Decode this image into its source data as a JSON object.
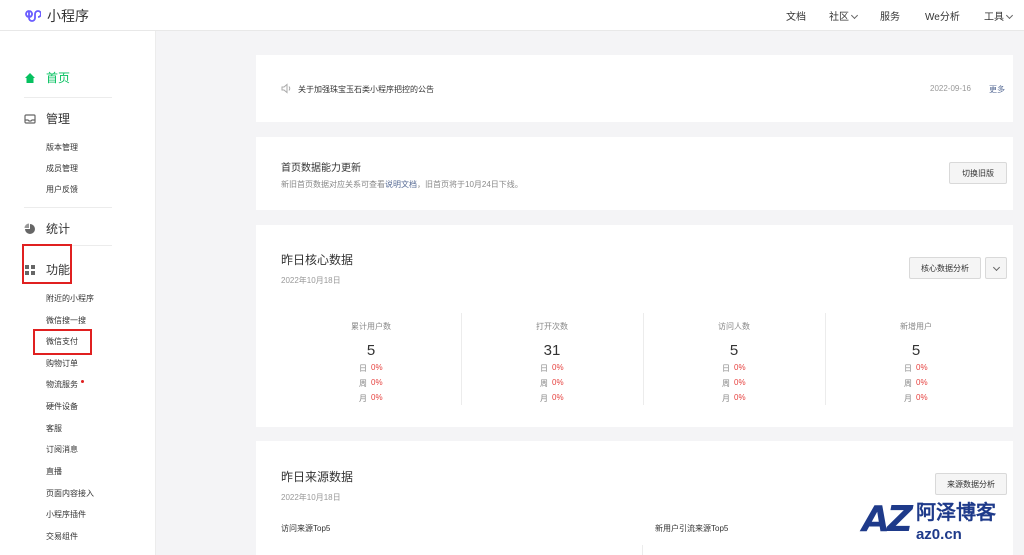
{
  "app": {
    "title": "小程序"
  },
  "topnav": [
    {
      "label": "文档"
    },
    {
      "label": "社区"
    },
    {
      "label": "服务"
    },
    {
      "label": "We分析"
    },
    {
      "label": "工具"
    }
  ],
  "sidebar": {
    "home": "首页",
    "manage": {
      "title": "管理",
      "items": [
        "版本管理",
        "成员管理",
        "用户反馈"
      ]
    },
    "stats": "统计",
    "features": {
      "title": "功能",
      "items": [
        "附近的小程序",
        "微信搜一搜",
        "微信支付",
        "购物订单",
        "物流服务",
        "硬件设备",
        "客服",
        "订阅消息",
        "直播",
        "页面内容接入",
        "小程序插件",
        "交易组件"
      ]
    }
  },
  "notice": {
    "text": "关于加强珠宝玉石类小程序把控的公告",
    "date": "2022-09-16",
    "more": "更多"
  },
  "update": {
    "title": "首页数据能力更新",
    "desc_prefix": "新旧首页数据对应关系可查看",
    "desc_link": "说明文档",
    "desc_suffix": "，旧首页将于10月24日下线。",
    "button": "切换旧版"
  },
  "core": {
    "title": "昨日核心数据",
    "date": "2022年10月18日",
    "button": "核心数据分析",
    "metrics": [
      {
        "label": "累计用户数",
        "value": "5",
        "day": "0%",
        "week": "0%",
        "month": "0%"
      },
      {
        "label": "打开次数",
        "value": "31",
        "day": "0%",
        "week": "0%",
        "month": "0%"
      },
      {
        "label": "访问人数",
        "value": "5",
        "day": "0%",
        "week": "0%",
        "month": "0%"
      },
      {
        "label": "新增用户",
        "value": "5",
        "day": "0%",
        "week": "0%",
        "month": "0%"
      }
    ],
    "row_labels": {
      "day": "日",
      "week": "周",
      "month": "月"
    }
  },
  "source": {
    "title": "昨日来源数据",
    "date": "2022年10月18日",
    "button": "来源数据分析",
    "left_label": "访问来源Top5",
    "right_label": "新用户引流来源Top5"
  },
  "watermark": {
    "cn": "阿泽博客",
    "url": "az0.cn",
    "logo": "AZ"
  },
  "colors": {
    "accent": "#07c160",
    "highlight": "#e02020",
    "link": "#576b95",
    "watermark": "#1e3a8a"
  }
}
